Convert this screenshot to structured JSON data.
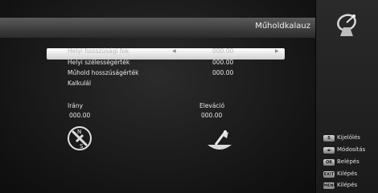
{
  "header": {
    "title": "Műholdkalauz"
  },
  "form": {
    "rows": [
      {
        "label": "Helyi hosszúsági fok",
        "value": "000.00"
      },
      {
        "label": "Helyi szélességérték",
        "value": "000.00"
      },
      {
        "label": "Műhold hosszúságérték",
        "value": "000.00"
      },
      {
        "label": "Kalkulál",
        "value": ""
      }
    ]
  },
  "result": {
    "direction_label": "Irány",
    "direction_value": "000.00",
    "elevation_label": "Eleváció",
    "elevation_value": "000.00"
  },
  "compass": {
    "n": "N",
    "s": "S"
  },
  "legend": [
    {
      "key": "S",
      "label": "Kijelölés"
    },
    {
      "key": "◂▸",
      "label": "Módosítás"
    },
    {
      "key": "OK",
      "label": "Belépés"
    },
    {
      "key": "EXIT",
      "label": "Kilépés"
    },
    {
      "key": "MENU",
      "label": "Kilépés"
    }
  ],
  "colors": {
    "highlight": "#e6e6e6",
    "background": "#151515",
    "text": "#e8e8e8"
  },
  "icons": {
    "logo": "satellite-dish-icon",
    "compass": "compass-icon",
    "dish": "dish-elevation-icon"
  }
}
